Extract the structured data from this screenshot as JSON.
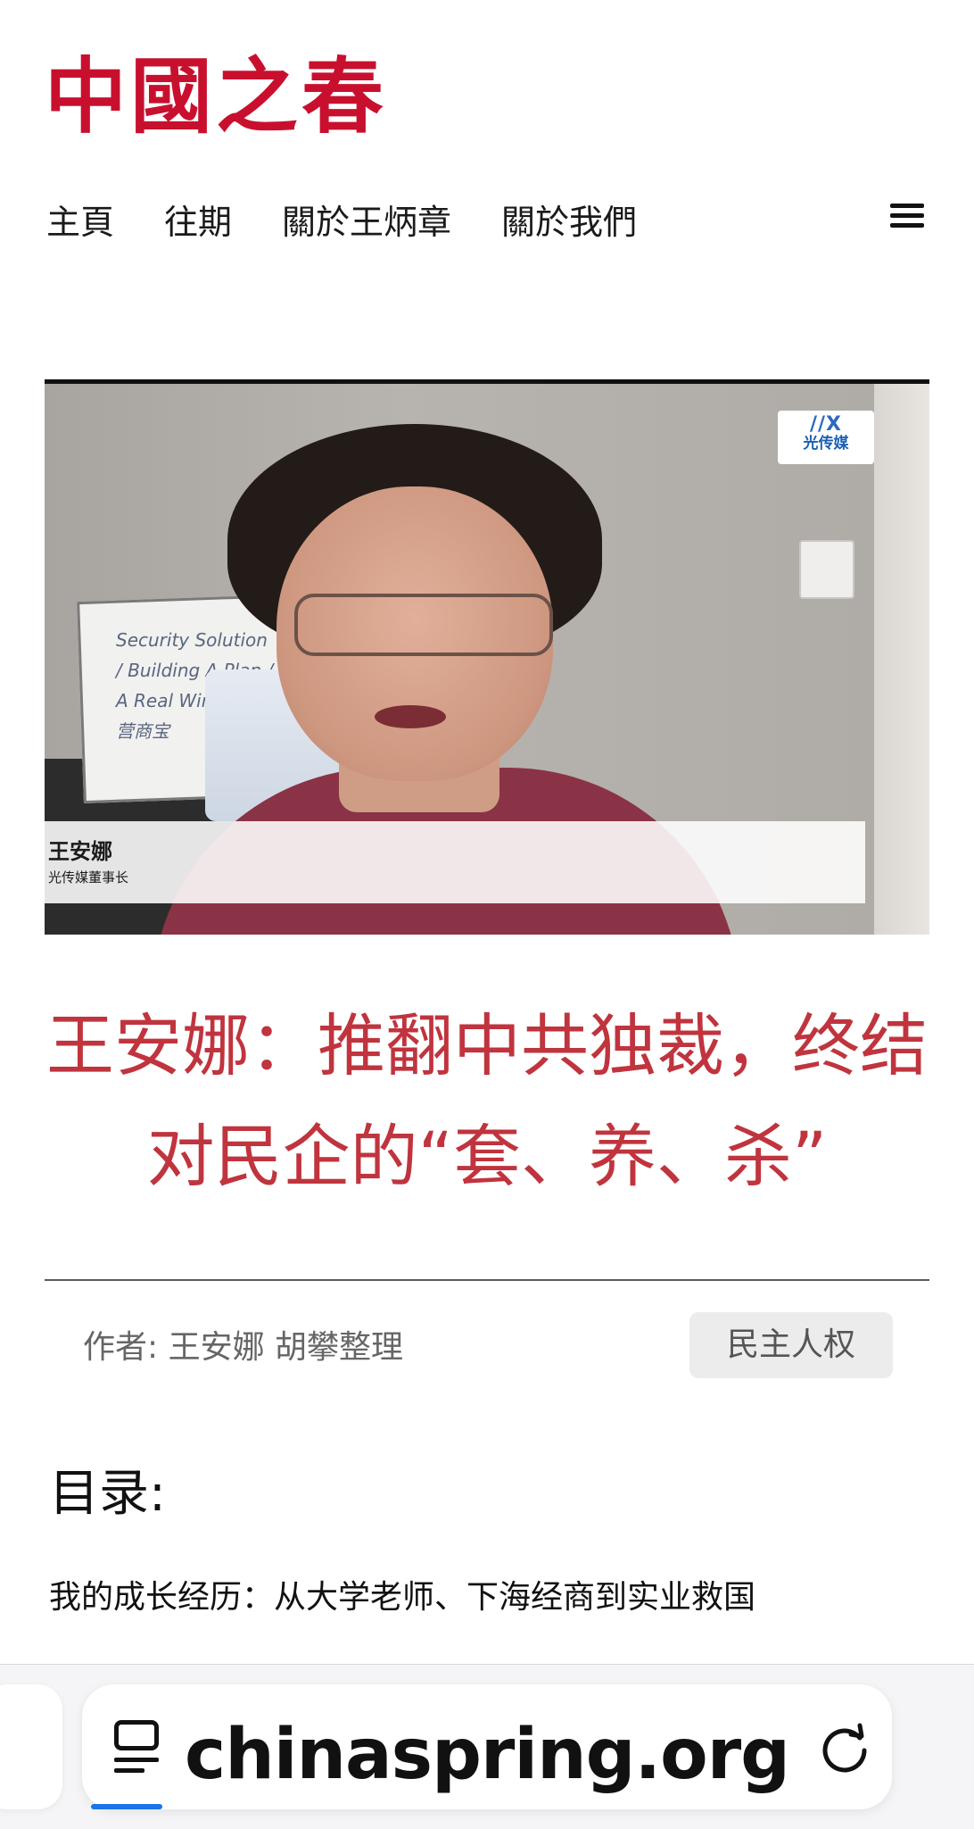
{
  "site": {
    "logo": "中國之春"
  },
  "nav": {
    "items": [
      "主頁",
      "往期",
      "關於王炳章",
      "關於我們"
    ]
  },
  "hero": {
    "name_label": "王安娜",
    "title_label": "光传媒董事长",
    "channel_badge": "光传媒",
    "board_text": "Security Solution / Building A Plan / A Real Winning / 营商宝"
  },
  "article": {
    "headline": "王安娜：推翻中共独裁，终结对民企的“套、养、杀”",
    "byline": "作者: 王安娜 胡攀整理",
    "category": "民主人权",
    "toc_title": "目录:",
    "toc_items": [
      "我的成长经历：从大学老师、下海经商到实业救国"
    ]
  },
  "browser": {
    "url": "chinaspring.org",
    "accent_color": "#1a73e8"
  },
  "colors": {
    "brand_red": "#c8102e",
    "headline_red": "#c0343e"
  }
}
